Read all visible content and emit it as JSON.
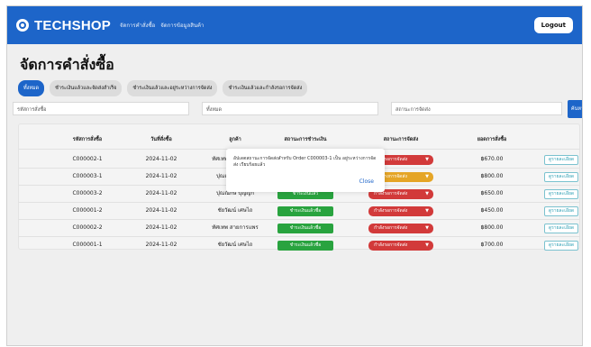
{
  "navbar": {
    "brand": "TECHSHOP",
    "links": [
      "จัดการคำสั่งซื้อ",
      "จัดการข้อมูลสินค้า"
    ],
    "logout": "Logout"
  },
  "page": {
    "title": "จัดการคำสั่งซื้อ"
  },
  "tabs": [
    {
      "label": "ทั้งหมด",
      "active": true
    },
    {
      "label": "ชำระเงินแล้วและจัดส่งสำเร็จ",
      "active": false
    },
    {
      "label": "ชำระเงินแล้วและอยู่ระหว่างการจัดส่ง",
      "active": false
    },
    {
      "label": "ชำระเงินแล้วและกำลังรอการจัดส่ง",
      "active": false
    }
  ],
  "filters": {
    "order_id_placeholder": "รหัสการสั่งซื้อ",
    "payment_value": "ทั้งหมด",
    "shipping_placeholder": "สถานะการจัดส่ง",
    "search_label": "ค้นหา"
  },
  "table": {
    "headers": [
      "รหัสการสั่งซื้อ",
      "วันที่สั่งซื้อ",
      "ลูกค้า",
      "สถานะการชำระเงิน",
      "สถานะการจัดส่ง",
      "ยอดการสั่งซื้อ"
    ],
    "rows": [
      {
        "id": "C000002-1",
        "date": "2024-11-02",
        "customer": "ทัศเทพ สายการแพร",
        "payment": "ชำระเงินแล้ว",
        "shipping": "กำลังรอการจัดส่ง",
        "status_color": "#d23a3a",
        "total": "฿670.00",
        "detail": "ดูรายละเอียด"
      },
      {
        "id": "C000003-1",
        "date": "2024-11-02",
        "customer": "ปุณณิกษ์ ปุญญิกี",
        "payment": "ชำระเงินแล้ว",
        "shipping": "ระหว่างการจัดส่ง",
        "status_color": "#e5a526",
        "total": "฿800.00",
        "detail": "ดูรายละเอียด"
      },
      {
        "id": "C000003-2",
        "date": "2024-11-02",
        "customer": "ปุณณิกษ์ ปุญญิกี",
        "payment": "ชำระเงินแล้ว",
        "shipping": "กำลังรอการจัดส่ง",
        "status_color": "#d23a3a",
        "total": "฿650.00",
        "detail": "ดูรายละเอียด"
      },
      {
        "id": "C000001-2",
        "date": "2024-11-02",
        "customer": "ชัยวัฒน์ เศษไถ",
        "payment": "ชำระเงินแล้วชื่อ",
        "shipping": "กำลังรอการจัดส่ง",
        "status_color": "#d23a3a",
        "total": "฿450.00",
        "detail": "ดูรายละเอียด"
      },
      {
        "id": "C000002-2",
        "date": "2024-11-02",
        "customer": "ทัศเทพ สายการแพร",
        "payment": "ชำระเงินแล้วชื่อ",
        "shipping": "กำลังรอการจัดส่ง",
        "status_color": "#d23a3a",
        "total": "฿800.00",
        "detail": "ดูรายละเอียด"
      },
      {
        "id": "C000001-1",
        "date": "2024-11-02",
        "customer": "ชัยวัฒน์ เศษไถ",
        "payment": "ชำระเงินแล้วชื่อ",
        "shipping": "กำลังรอการจัดส่ง",
        "status_color": "#d23a3a",
        "total": "฿700.00",
        "detail": "ดูรายละเอียด"
      }
    ]
  },
  "modal": {
    "message": "อัปเดตสถานะการจัดส่งสำหรับ Order C000003-1 เป็น อยู่ระหว่างการจัดส่ง เรียบร้อยแล้ว",
    "close": "Close"
  },
  "colors": {
    "primary": "#1d65c9",
    "paid": "#29a33f",
    "pending": "#d23a3a",
    "shipping": "#e5a526"
  }
}
